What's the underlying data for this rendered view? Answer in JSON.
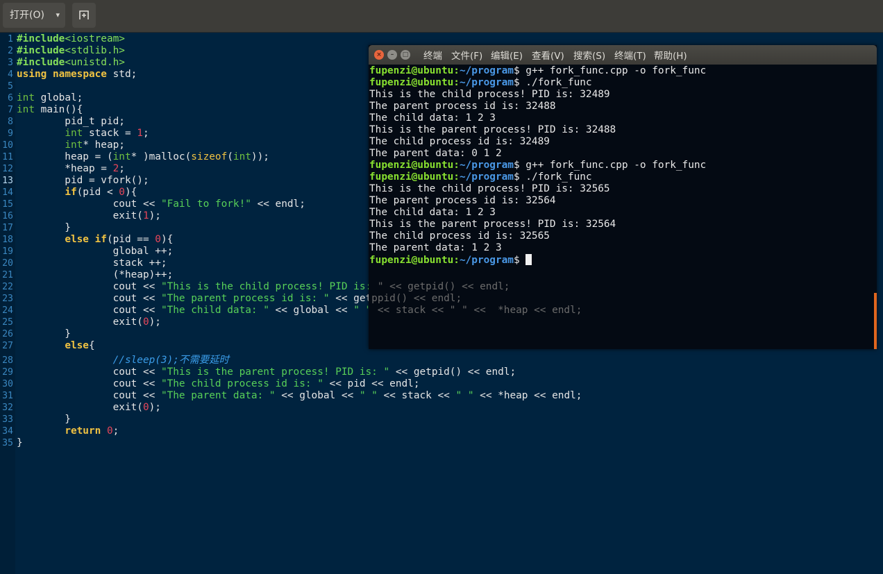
{
  "header": {
    "open_label": "打开(O)",
    "open_caret": "▾",
    "new_document_icon": "new-document-icon"
  },
  "editor": {
    "current_line": 13,
    "line_numbers": [
      "1",
      "2",
      "3",
      "4",
      "5",
      "6",
      "7",
      "8",
      "9",
      "10",
      "11",
      "12",
      "13",
      "14",
      "15",
      "16",
      "17",
      "18",
      "19",
      "20",
      "21",
      "22",
      "23",
      "24",
      "25",
      "26",
      "27",
      "28",
      "29",
      "30",
      "31",
      "32",
      "33",
      "34",
      "35"
    ],
    "lines": [
      [
        [
          "pp",
          "#include"
        ],
        [
          "ppfile",
          "<iostream>"
        ]
      ],
      [
        [
          "pp",
          "#include"
        ],
        [
          "ppfile",
          "<stdlib.h>"
        ]
      ],
      [
        [
          "pp",
          "#include"
        ],
        [
          "ppfile",
          "<unistd.h>"
        ]
      ],
      [
        [
          "kw",
          "using"
        ],
        [
          "t",
          " "
        ],
        [
          "kw",
          "namespace"
        ],
        [
          "t",
          " std;"
        ]
      ],
      [],
      [
        [
          "type",
          "int"
        ],
        [
          "t",
          " global;"
        ]
      ],
      [
        [
          "type",
          "int"
        ],
        [
          "t",
          " main(){"
        ]
      ],
      [
        [
          "t",
          "        pid_t pid;"
        ]
      ],
      [
        [
          "t",
          "        "
        ],
        [
          "type",
          "int"
        ],
        [
          "t",
          " stack = "
        ],
        [
          "num",
          "1"
        ],
        [
          "t",
          ";"
        ]
      ],
      [
        [
          "t",
          "        "
        ],
        [
          "type",
          "int"
        ],
        [
          "t",
          "* heap;"
        ]
      ],
      [
        [
          "t",
          "        heap = ("
        ],
        [
          "type",
          "int"
        ],
        [
          "t",
          "* )malloc("
        ],
        [
          "fn",
          "sizeof"
        ],
        [
          "t",
          "("
        ],
        [
          "type",
          "int"
        ],
        [
          "t",
          "));"
        ]
      ],
      [
        [
          "t",
          "        *heap = "
        ],
        [
          "num",
          "2"
        ],
        [
          "t",
          ";"
        ]
      ],
      [
        [
          "t",
          "        pid = vfork();"
        ]
      ],
      [
        [
          "t",
          "        "
        ],
        [
          "kw",
          "if"
        ],
        [
          "t",
          "(pid < "
        ],
        [
          "num",
          "0"
        ],
        [
          "t",
          "){"
        ]
      ],
      [
        [
          "t",
          "                cout << "
        ],
        [
          "str",
          "\"Fail to fork!\""
        ],
        [
          "t",
          " << endl;"
        ]
      ],
      [
        [
          "t",
          "                exit("
        ],
        [
          "num",
          "1"
        ],
        [
          "t",
          ");"
        ]
      ],
      [
        [
          "t",
          "        }"
        ]
      ],
      [
        [
          "t",
          "        "
        ],
        [
          "kw",
          "else"
        ],
        [
          "t",
          " "
        ],
        [
          "kw",
          "if"
        ],
        [
          "t",
          "(pid == "
        ],
        [
          "num",
          "0"
        ],
        [
          "t",
          "){"
        ]
      ],
      [
        [
          "t",
          "                global ++;"
        ]
      ],
      [
        [
          "t",
          "                stack ++;"
        ]
      ],
      [
        [
          "t",
          "                (*heap)++;"
        ]
      ],
      [
        [
          "t",
          "                cout << "
        ],
        [
          "str",
          "\"This is the child process! PID is: \""
        ],
        [
          "t",
          " << getpid() << endl;"
        ]
      ],
      [
        [
          "t",
          "                cout << "
        ],
        [
          "str",
          "\"The parent process id is: \""
        ],
        [
          "t",
          " << getppid() << endl;"
        ]
      ],
      [
        [
          "t",
          "                cout << "
        ],
        [
          "str",
          "\"The child data: \""
        ],
        [
          "t",
          " << global << "
        ],
        [
          "str",
          "\" \""
        ],
        [
          "t",
          " << stack << "
        ],
        [
          "str",
          "\" \""
        ],
        [
          "t",
          " <<  *heap << endl;"
        ]
      ],
      [
        [
          "t",
          "                exit("
        ],
        [
          "num",
          "0"
        ],
        [
          "t",
          ");"
        ]
      ],
      [
        [
          "t",
          "        }"
        ]
      ],
      [
        [
          "t",
          "        "
        ],
        [
          "kw",
          "else"
        ],
        [
          "t",
          "{"
        ]
      ],
      [
        [
          "t",
          "                "
        ],
        [
          "cm",
          "//sleep(3);不需要延时"
        ]
      ],
      [
        [
          "t",
          "                cout << "
        ],
        [
          "str",
          "\"This is the parent process! PID is: \""
        ],
        [
          "t",
          " << getpid() << endl;"
        ]
      ],
      [
        [
          "t",
          "                cout << "
        ],
        [
          "str",
          "\"The child process id is: \""
        ],
        [
          "t",
          " << pid << endl;"
        ]
      ],
      [
        [
          "t",
          "                cout << "
        ],
        [
          "str",
          "\"The parent data: \""
        ],
        [
          "t",
          " << global << "
        ],
        [
          "str",
          "\" \""
        ],
        [
          "t",
          " << stack << "
        ],
        [
          "str",
          "\" \""
        ],
        [
          "t",
          " << *heap << endl;"
        ]
      ],
      [
        [
          "t",
          "                exit("
        ],
        [
          "num",
          "0"
        ],
        [
          "t",
          ");"
        ]
      ],
      [
        [
          "t",
          "        }"
        ]
      ],
      [
        [
          "t",
          "        "
        ],
        [
          "kw",
          "return"
        ],
        [
          "t",
          " "
        ],
        [
          "num",
          "0"
        ],
        [
          "t",
          ";"
        ]
      ],
      [
        [
          "t",
          "}"
        ]
      ]
    ],
    "ghost_lines": [
      "                cout << \"This is the child process! PID is: \" << getpid() << endl;",
      "                cout << \"The parent process id is: \" << getppid() << endl;",
      "                cout << \"The child data: \" << global << \" \" << stack << \" \" <<  *heap << endl;"
    ]
  },
  "terminal": {
    "close_glyph": "×",
    "min_glyph": "–",
    "max_glyph": "□",
    "menu": [
      "终端",
      "文件(F)",
      "编辑(E)",
      "查看(V)",
      "搜索(S)",
      "终端(T)",
      "帮助(H)"
    ],
    "lines": [
      {
        "user": "fupenzi@ubuntu",
        "path": "~/program",
        "cmd": "g++ fork_func.cpp -o fork_func"
      },
      {
        "user": "fupenzi@ubuntu",
        "path": "~/program",
        "cmd": "./fork_func"
      },
      {
        "out": "This is the child process! PID is: 32489"
      },
      {
        "out": "The parent process id is: 32488"
      },
      {
        "out": "The child data: 1 2 3"
      },
      {
        "out": "This is the parent process! PID is: 32488"
      },
      {
        "out": "The child process id is: 32489"
      },
      {
        "out": "The parent data: 0 1 2"
      },
      {
        "user": "fupenzi@ubuntu",
        "path": "~/program",
        "cmd": "g++ fork_func.cpp -o fork_func"
      },
      {
        "user": "fupenzi@ubuntu",
        "path": "~/program",
        "cmd": "./fork_func"
      },
      {
        "out": "This is the child process! PID is: 32565"
      },
      {
        "out": "The parent process id is: 32564"
      },
      {
        "out": "The child data: 1 2 3"
      },
      {
        "out": "This is the parent process! PID is: 32564"
      },
      {
        "out": "The child process id is: 32565"
      },
      {
        "out": "The parent data: 1 2 3"
      },
      {
        "user": "fupenzi@ubuntu",
        "path": "~/program",
        "cmd": "",
        "cursor": true
      }
    ]
  }
}
